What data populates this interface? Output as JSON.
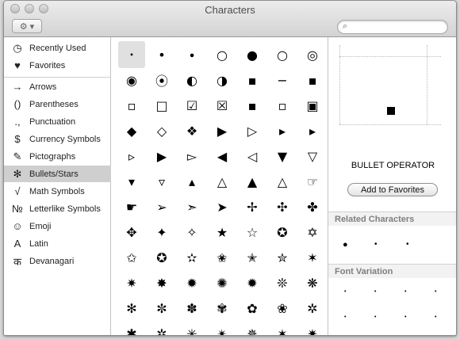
{
  "window": {
    "title": "Characters"
  },
  "toolbar": {
    "action_label": "⚙ ▾",
    "search_placeholder": ""
  },
  "sidebar": {
    "items": [
      {
        "label": "Recently Used",
        "icon": "◷",
        "icon_name": "clock-icon"
      },
      {
        "label": "Favorites",
        "icon": "♥",
        "icon_name": "heart-icon"
      },
      {
        "label": "Arrows",
        "icon": "→",
        "icon_name": "arrow-icon"
      },
      {
        "label": "Parentheses",
        "icon": "()",
        "icon_name": "parentheses-icon"
      },
      {
        "label": "Punctuation",
        "icon": ".,",
        "icon_name": "punctuation-icon"
      },
      {
        "label": "Currency Symbols",
        "icon": "$",
        "icon_name": "dollar-icon"
      },
      {
        "label": "Pictographs",
        "icon": "✎",
        "icon_name": "pictograph-icon"
      },
      {
        "label": "Bullets/Stars",
        "icon": "✻",
        "icon_name": "star-icon"
      },
      {
        "label": "Math Symbols",
        "icon": "√",
        "icon_name": "sqrt-icon"
      },
      {
        "label": "Letterlike Symbols",
        "icon": "№",
        "icon_name": "numero-icon"
      },
      {
        "label": "Emoji",
        "icon": "☺",
        "icon_name": "smiley-icon"
      },
      {
        "label": "Latin",
        "icon": "A",
        "icon_name": "latin-icon"
      },
      {
        "label": "Devanagari",
        "icon": "क",
        "icon_name": "devanagari-icon"
      }
    ],
    "selected_index": 7
  },
  "grid": {
    "rows": [
      [
        "∙",
        "•",
        "∙",
        "○",
        "●",
        "○",
        "◎"
      ],
      [
        "◉",
        "⦿",
        "◐",
        "◑",
        "▪",
        "−",
        "▪"
      ],
      [
        "▫",
        "□",
        "☑",
        "☒",
        "▪",
        "▫",
        "▣"
      ],
      [
        "◆",
        "◇",
        "❖",
        "▶",
        "▷",
        "▸",
        "▸"
      ],
      [
        "▹",
        "▶",
        "▻",
        "◀",
        "◁",
        "▼",
        "▽"
      ],
      [
        "▾",
        "▿",
        "▴",
        "△",
        "▲",
        "△",
        "☞"
      ],
      [
        "☛",
        "➢",
        "➣",
        "➤",
        "✢",
        "✣",
        "✤"
      ],
      [
        "✥",
        "✦",
        "✧",
        "★",
        "☆",
        "✪",
        "✡"
      ],
      [
        "✩",
        "✪",
        "✫",
        "✬",
        "✭",
        "✮",
        "✶"
      ],
      [
        "✷",
        "✸",
        "✹",
        "✺",
        "✹",
        "❊",
        "❋"
      ],
      [
        "✻",
        "✼",
        "✽",
        "✾",
        "✿",
        "❀",
        "✲"
      ],
      [
        "✱",
        "✲",
        "✳",
        "✴",
        "✵",
        "✶",
        "✷"
      ]
    ],
    "selected": "0,0"
  },
  "detail": {
    "char_name": "BULLET OPERATOR",
    "favorites_button": "Add to Favorites",
    "related_heading": "Related Characters",
    "related": [
      "●",
      "•",
      "•"
    ],
    "variation_heading": "Font Variation",
    "variations": [
      "•",
      "•",
      "•",
      "•",
      "•",
      "•",
      "•",
      "•",
      "•",
      "•"
    ]
  }
}
